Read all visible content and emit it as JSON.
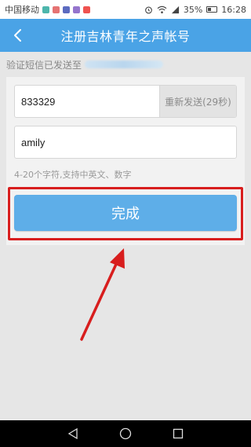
{
  "status_bar": {
    "carrier": "中国移动",
    "battery_percent": "35%",
    "time": "16:28",
    "app_icon_colors": [
      "#4db6ac",
      "#e57373",
      "#5c6bc0",
      "#9575cd",
      "#ef5350"
    ]
  },
  "header": {
    "title": "注册吉林青年之声帐号",
    "back_icon": "chevron-left-icon",
    "color": "#4aa3e6"
  },
  "notice": {
    "label": "验证短信已发送至"
  },
  "form": {
    "code_value": "833329",
    "resend_label": "重新发送(29秒)",
    "name_value": "amily",
    "hint": "4-20个字符,支持中英文、数字"
  },
  "actions": {
    "done_label": "完成",
    "done_color": "#5eaee8"
  },
  "annotation": {
    "highlight_color": "#d81e1e"
  },
  "nav": {
    "buttons": [
      "back-triangle-icon",
      "home-circle-icon",
      "recents-square-icon"
    ]
  }
}
